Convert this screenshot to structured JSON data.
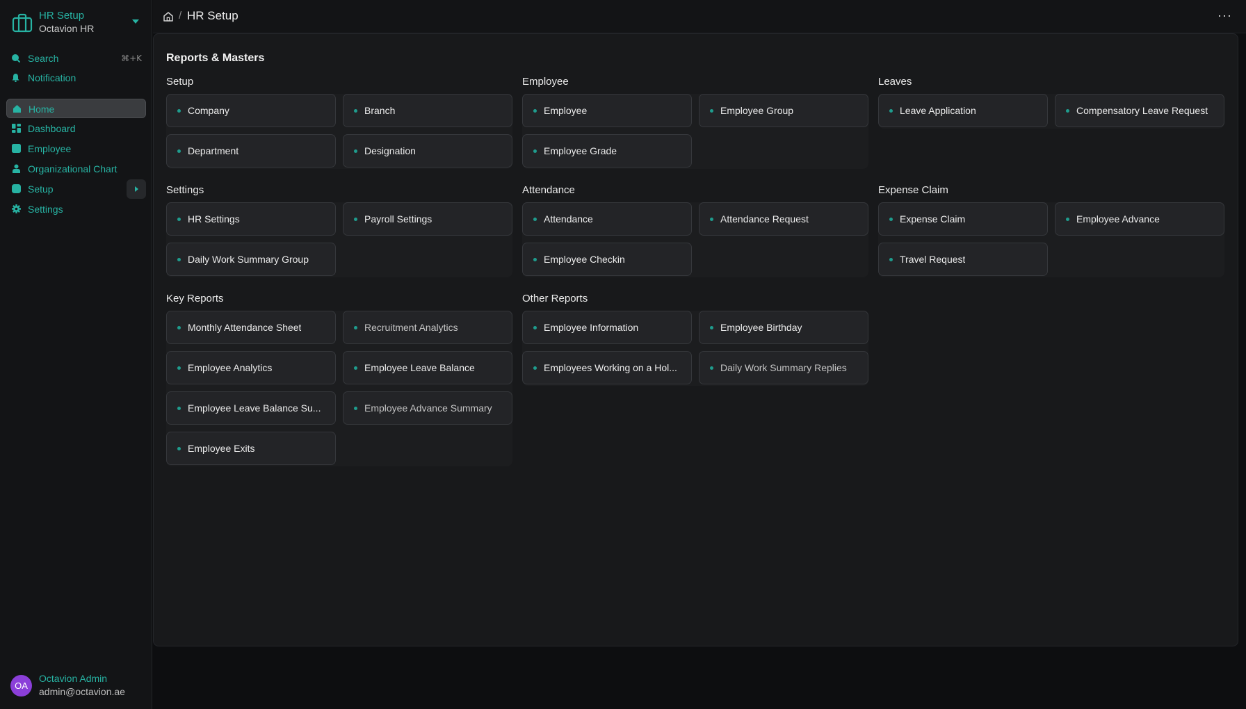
{
  "workspace": {
    "title": "HR Setup",
    "subtitle": "Octavion HR"
  },
  "utilities": [
    {
      "label": "Search",
      "shortcut": "⌘+K"
    },
    {
      "label": "Notification"
    }
  ],
  "nav": [
    {
      "label": "Home",
      "icon": "home-icon"
    },
    {
      "label": "Dashboard",
      "icon": "dashboard-icon"
    },
    {
      "label": "Employee",
      "icon": "employee-icon"
    },
    {
      "label": "Organizational Chart",
      "icon": "org-chart-icon"
    },
    {
      "label": "Setup",
      "icon": "setup-icon"
    },
    {
      "label": "Settings",
      "icon": "gear-icon"
    }
  ],
  "user": {
    "initials": "OA",
    "name": "Octavion Admin",
    "email": "admin@octavion.ae"
  },
  "breadcrumb": {
    "separator": "/",
    "title": "HR Setup"
  },
  "topbar": {
    "more": "···"
  },
  "accent_color": "#27b3a3",
  "section_title": "Reports & Masters",
  "groups": [
    {
      "title": "Setup",
      "items": [
        "Company",
        "Branch",
        "Department",
        "Designation"
      ]
    },
    {
      "title": "Employee",
      "items": [
        "Employee",
        "Employee Group",
        "Employee Grade"
      ]
    },
    {
      "title": "Leaves",
      "items": [
        "Leave Application",
        "Compensatory Leave Request"
      ]
    },
    {
      "title": "Settings",
      "items": [
        "HR Settings",
        "Payroll Settings",
        "Daily Work Summary Group"
      ]
    },
    {
      "title": "Attendance",
      "items": [
        "Attendance",
        "Attendance Request",
        "Employee Checkin"
      ]
    },
    {
      "title": "Expense Claim",
      "items": [
        "Expense Claim",
        "Employee Advance",
        "Travel Request"
      ]
    },
    {
      "title": "Key Reports",
      "items": [
        "Monthly Attendance Sheet",
        "Recruitment Analytics",
        "Employee Analytics",
        "Employee Leave Balance",
        "Employee Leave Balance Su...",
        "Employee Advance Summary",
        "Employee Exits"
      ]
    },
    {
      "title": "Other Reports",
      "items": [
        "Employee Information",
        "Employee Birthday",
        "Employees Working on a Hol...",
        "Daily Work Summary Replies"
      ]
    }
  ]
}
